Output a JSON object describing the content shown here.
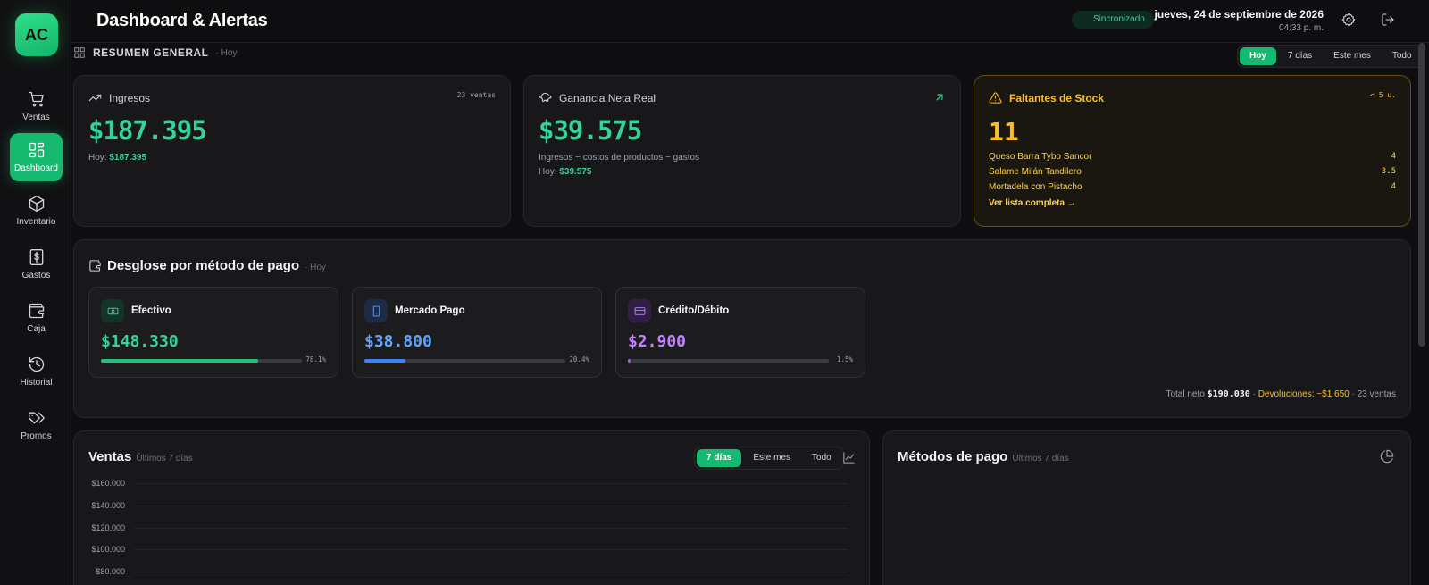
{
  "app": {
    "logo_text": "AC"
  },
  "sidebar": {
    "items": [
      {
        "label": "Ventas",
        "icon": "cart-icon",
        "active": false
      },
      {
        "label": "Dashboard",
        "icon": "dashboard-icon",
        "active": true
      },
      {
        "label": "Inventario",
        "icon": "box-icon",
        "active": false
      },
      {
        "label": "Gastos",
        "icon": "receipt-dollar-icon",
        "active": false
      },
      {
        "label": "Caja",
        "icon": "wallet-icon",
        "active": false
      },
      {
        "label": "Historial",
        "icon": "history-icon",
        "active": false
      },
      {
        "label": "Promos",
        "icon": "tags-icon",
        "active": false
      }
    ]
  },
  "header": {
    "title": "Dashboard & Alertas",
    "sync_status": "Sincronizado",
    "date": "jueves, 24 de septiembre de 2026",
    "time": "04:33 p. m."
  },
  "summary": {
    "title": "RESUMEN GENERAL",
    "period_hint": "· Hoy",
    "ranges": [
      "Hoy",
      "7 días",
      "Este mes",
      "Todo"
    ],
    "selected_range": "Hoy"
  },
  "ingresos": {
    "title": "Ingresos",
    "sales_count": "23 ventas",
    "value": "$187.395",
    "today_label": "Hoy:",
    "today_value": "$187.395"
  },
  "ganancia": {
    "title": "Ganancia Neta Real",
    "value": "$39.575",
    "formula": "Ingresos − costos de productos − gastos",
    "today_label": "Hoy:",
    "today_value": "$39.575"
  },
  "stock": {
    "title": "Faltantes de Stock",
    "threshold": "< 5 u.",
    "count": "11",
    "items": [
      {
        "name": "Queso Barra Tybo Sancor",
        "qty": "4"
      },
      {
        "name": "Salame Milán Tandilero",
        "qty": "3.5"
      },
      {
        "name": "Mortadela con Pistacho",
        "qty": "4"
      }
    ],
    "link": "Ver lista completa →"
  },
  "payments": {
    "title": "Desglose por método de pago",
    "period": "· Hoy",
    "methods": [
      {
        "label": "Efectivo",
        "amount": "$148.330",
        "percent": 78.1,
        "percent_label": "78.1%",
        "color": "#34d399",
        "bar_color": "#22c07a",
        "icon": "cash-icon"
      },
      {
        "label": "Mercado Pago",
        "amount": "$38.800",
        "percent": 20.4,
        "percent_label": "20.4%",
        "color": "#60a5fa",
        "bar_color": "#3b82f6",
        "icon": "phone-icon"
      },
      {
        "label": "Crédito/Débito",
        "amount": "$2.900",
        "percent": 1.5,
        "percent_label": "1.5%",
        "color": "#c084fc",
        "bar_color": "#a855f7",
        "icon": "card-icon"
      }
    ],
    "totals": {
      "net_label": "Total neto",
      "net_value": "$190.030",
      "returns": "Devoluciones: −$1.650",
      "sales": "· 23 ventas"
    }
  },
  "sales_chart": {
    "title": "Ventas",
    "period": "Últimos 7 días",
    "ranges": [
      "7 días",
      "Este mes",
      "Todo"
    ],
    "selected_range": "7 días"
  },
  "methods_chart": {
    "title": "Métodos de pago",
    "period": "Últimos 7 días"
  },
  "chart_data": {
    "type": "line",
    "title": "Ventas",
    "x": [],
    "series": [],
    "yticks": [
      "$160.000",
      "$140.000",
      "$120.000",
      "$100.000",
      "$80.000"
    ],
    "ylim": [
      80000,
      160000
    ],
    "grid": true
  },
  "colors": {
    "accent": "#16b970",
    "warning": "#fbbf24",
    "info": "#3b82f6",
    "purple": "#a855f7"
  }
}
